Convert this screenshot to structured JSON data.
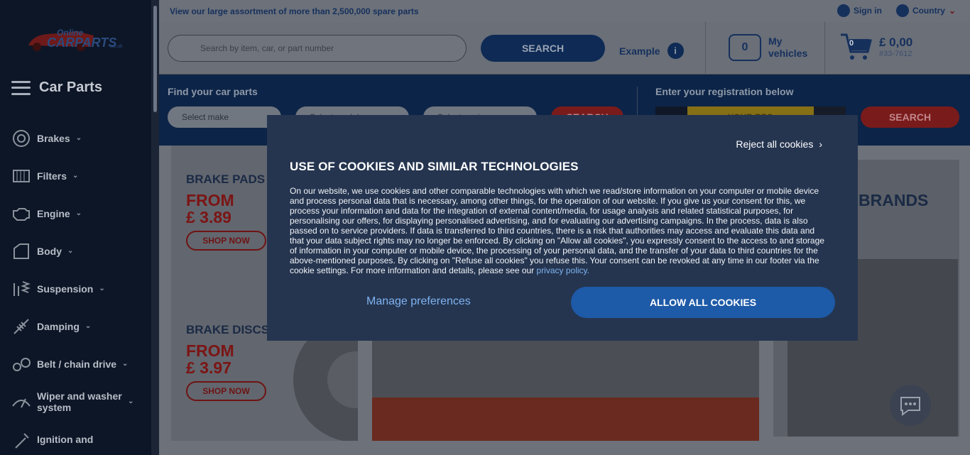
{
  "topbar": {
    "promo": "View our large assortment of more than 2,500,000 spare parts",
    "sign_in": "Sign in",
    "country": "Country"
  },
  "logo": {
    "line1": "Online",
    "line2": "CARPARTS",
    "suffix": ".co.uk"
  },
  "header": {
    "search_placeholder": "Search by item, car, or part number",
    "search_button": "SEARCH",
    "example_label": "Example",
    "vehicles_count": "0",
    "vehicles_label_1": "My",
    "vehicles_label_2": "vehicles",
    "cart_count": "0",
    "cart_total": "£ 0,00",
    "cart_phone": "#33-7612"
  },
  "sidebar": {
    "title": "Car Parts",
    "items": [
      {
        "label": "Brakes",
        "icon": "brake-disc-icon"
      },
      {
        "label": "Filters",
        "icon": "filter-icon"
      },
      {
        "label": "Engine",
        "icon": "engine-icon"
      },
      {
        "label": "Body",
        "icon": "car-body-icon"
      },
      {
        "label": "Suspension",
        "icon": "suspension-icon"
      },
      {
        "label": "Damping",
        "icon": "shock-absorber-icon"
      },
      {
        "label": "Belt / chain drive",
        "icon": "belt-drive-icon"
      },
      {
        "label": "Wiper and washer system",
        "icon": "wiper-icon"
      },
      {
        "label": "Ignition and",
        "icon": "spark-plug-icon"
      }
    ]
  },
  "finder": {
    "heading": "Find your car parts",
    "make": "Select make",
    "model": "Select model",
    "engine": "Select engine",
    "search": "SEARCH",
    "reg_heading": "Enter your registration below",
    "reg_placeholder": "YOUR REG",
    "reg_search": "SEARCH"
  },
  "banners": {
    "pads_title": "BRAKE PADS",
    "pads_from": "FROM",
    "pads_price": "£ 3.89",
    "pads_cta": "SHOP NOW",
    "discs_title": "BRAKE DISCS",
    "discs_from": "FROM",
    "discs_price": "£ 3.97",
    "discs_cta": "SHOP NOW",
    "brands_title": "BRANDS"
  },
  "cookie": {
    "reject": "Reject all cookies",
    "title": "USE OF COOKIES AND SIMILAR TECHNOLOGIES",
    "body": "On our website, we use cookies and other comparable technologies with which we read/store information on your computer or mobile device and process personal data that is necessary, among other things, for the operation of our website. If you give us your consent for this, we process your information and data for the integration of external content/media, for usage analysis and related statistical purposes, for personalising our offers, for displaying personalised advertising, and for evaluating our advertising campaigns. In the process, data is also passed on to service providers. If data is transferred to third countries, there is a risk that authorities may access and evaluate this data and that your data subject rights may no longer be enforced. By clicking on \"Allow all cookies\", you expressly consent to the access to and storage of information in your computer or mobile device, the processing of your personal data, and the transfer of your data to third countries for the above-mentioned purposes. By clicking on \"Refuse all cookies\" you refuse this. Your consent can be revoked at any time in our footer via the cookie settings. For more information and details, please see our ",
    "privacy_link": "privacy policy.",
    "manage": "Manage preferences",
    "allow": "ALLOW ALL COOKIES"
  }
}
